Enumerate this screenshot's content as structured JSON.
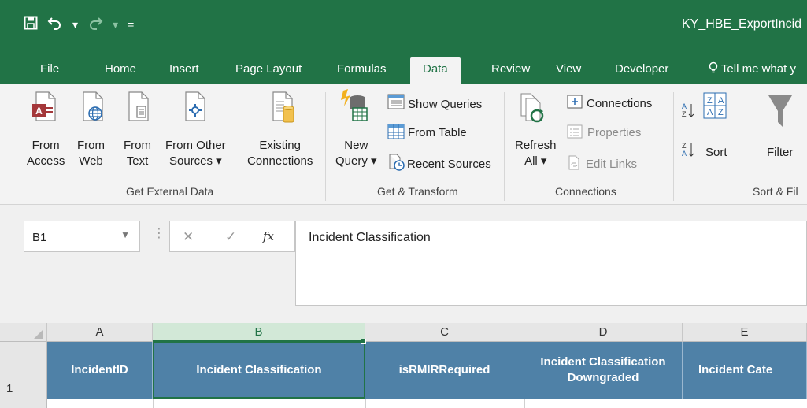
{
  "app": {
    "filename": "KY_HBE_ExportIncid",
    "accent": "#217346"
  },
  "qat": {
    "save_icon": "save-icon",
    "undo_icon": "undo-icon",
    "redo_icon": "redo-icon",
    "customize_icon": "customize-qat-icon"
  },
  "tabs": {
    "file": "File",
    "home": "Home",
    "insert": "Insert",
    "page_layout": "Page Layout",
    "formulas": "Formulas",
    "data": "Data",
    "review": "Review",
    "view": "View",
    "developer": "Developer",
    "tell_me": "Tell me what y"
  },
  "ribbon": {
    "get_external": {
      "label": "Get External Data",
      "from_access_1": "From",
      "from_access_2": "Access",
      "from_web_1": "From",
      "from_web_2": "Web",
      "from_text_1": "From",
      "from_text_2": "Text",
      "from_other_1": "From Other",
      "from_other_2": "Sources ▾",
      "existing_1": "Existing",
      "existing_2": "Connections"
    },
    "get_transform": {
      "label": "Get & Transform",
      "new_query_1": "New",
      "new_query_2": "Query ▾",
      "show_queries": "Show Queries",
      "from_table": "From Table",
      "recent_sources": "Recent Sources"
    },
    "connections": {
      "label": "Connections",
      "refresh_1": "Refresh",
      "refresh_2": "All ▾",
      "connections": "Connections",
      "properties": "Properties",
      "edit_links": "Edit Links"
    },
    "sort_filter": {
      "label": "Sort & Fil",
      "sort": "Sort",
      "filter": "Filter"
    }
  },
  "formula_bar": {
    "name_box": "B1",
    "cancel_glyph": "✕",
    "enter_glyph": "✓",
    "fx_glyph": "fx",
    "content": "Incident Classification"
  },
  "grid": {
    "columns": [
      "A",
      "B",
      "C",
      "D",
      "E"
    ],
    "row_number": "1",
    "row1": {
      "a": "IncidentID",
      "b": "Incident Classification",
      "c": "isRMIRRequired",
      "d1": "Incident Classification",
      "d2": "Downgraded",
      "e": "Incident Cate"
    },
    "header_fill": "#4f81a7"
  }
}
